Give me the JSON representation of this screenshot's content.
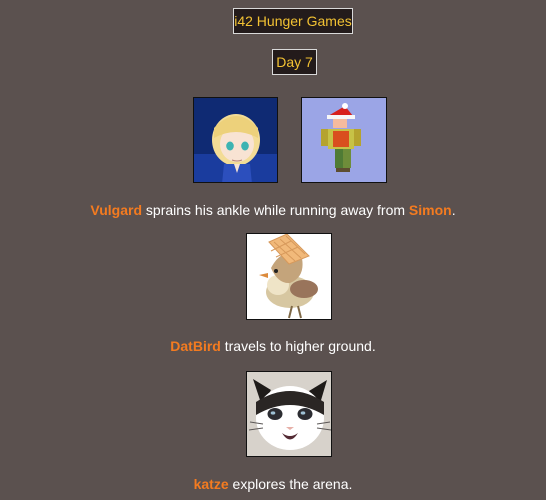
{
  "header": {
    "title": "i42 Hunger Games",
    "day": "Day 7"
  },
  "events": [
    {
      "actor": "Vulgard",
      "action": " sprains his ankle while running away from ",
      "target": "Simon",
      "end": "."
    },
    {
      "actor": "DatBird",
      "action": " travels to higher ground."
    },
    {
      "actor": "katze",
      "action": " explores the arena."
    }
  ],
  "colors": {
    "background": "#5b514f",
    "name": "#f47b20",
    "title": "#f2c233"
  }
}
